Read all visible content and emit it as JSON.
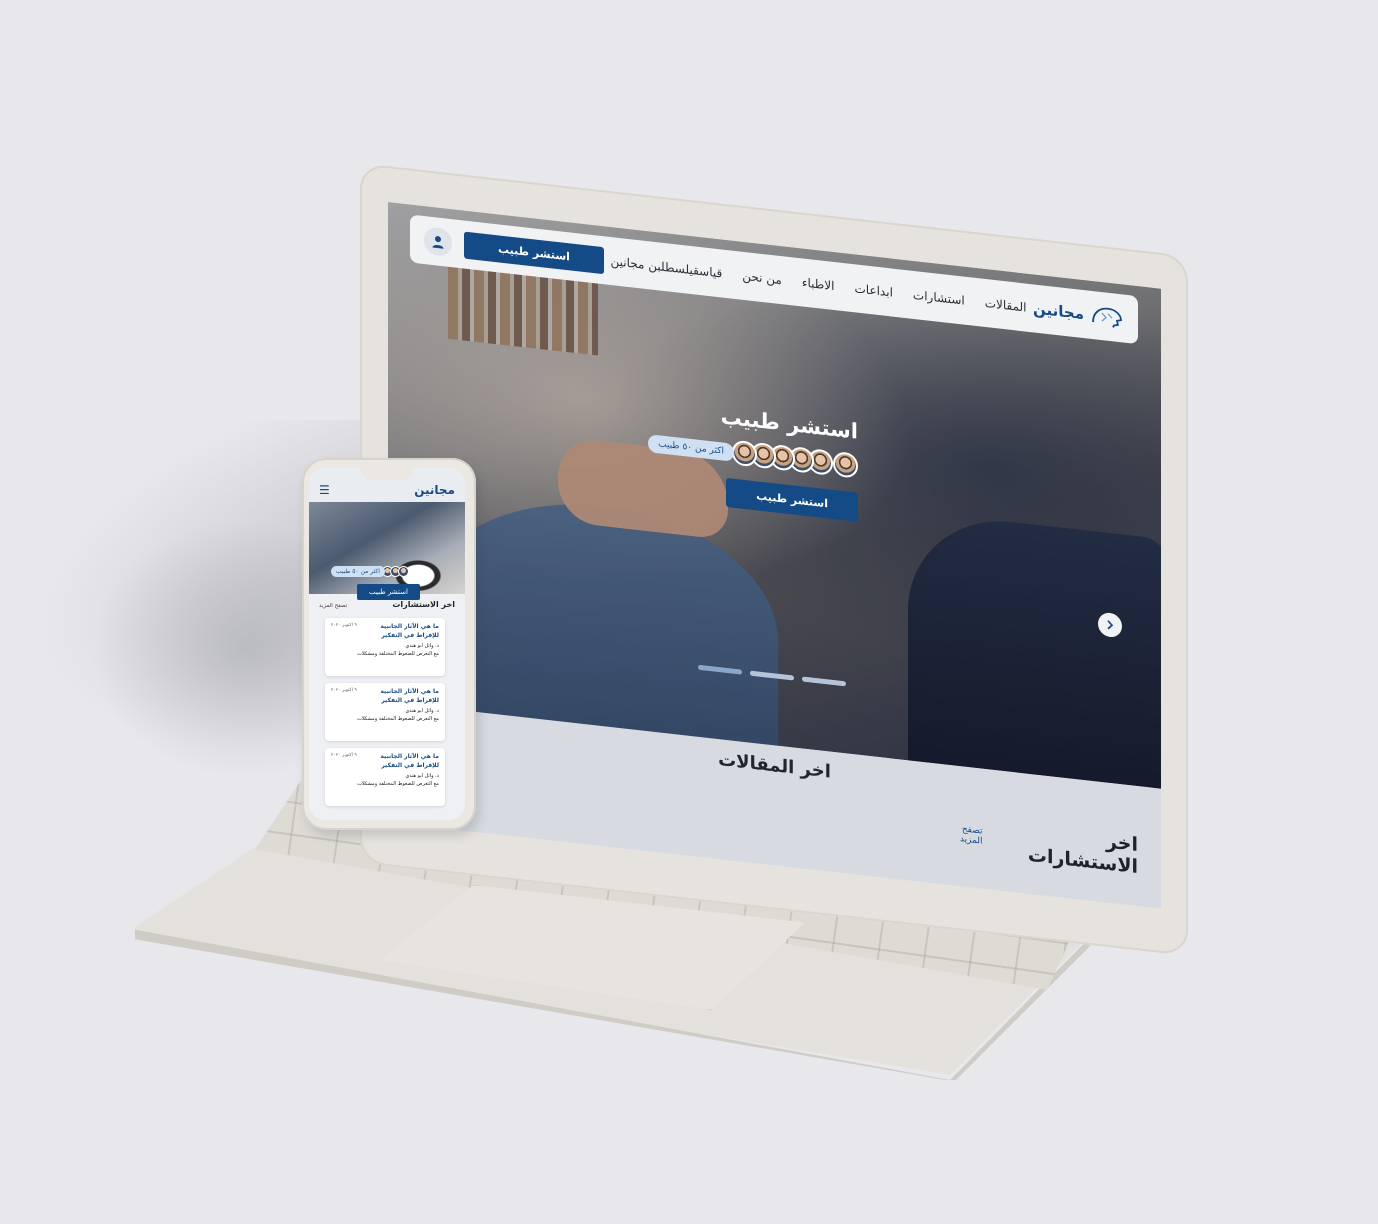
{
  "nav": {
    "logo": "مجانين",
    "links": [
      "المقالات",
      "استشارات",
      "ابداعات",
      "الاطباء",
      "من نحن",
      "قياسقيلسطلبن مجانين"
    ],
    "cta_label": "استشر طبيب"
  },
  "hero": {
    "title": "استشر طبيب",
    "doctors_badge": "اكثر من ٥٠ طبيب",
    "button_label": "استشر طبيب"
  },
  "sections": {
    "articles_title": "اخر المقالات",
    "consultations_title": "اخر الاستشارات",
    "more_link": "تصفح المزيد"
  },
  "mobile": {
    "logo": "مجانين",
    "badge": "اكثر من ٥٠ طبيب",
    "button_label": "استشر طبيب",
    "section_title": "اخر الاستشارات",
    "more_link": "تصفح المزيد",
    "cards": [
      {
        "question": "ما هي الآثار الجانبية للإفراط في التفكير",
        "date": "٩ اكتوبر ٢٠٢٠",
        "author": "د. وائل ابو هندي",
        "desc": "مع التعرض للضغوط المختلفة ومشكلات"
      },
      {
        "question": "ما هي الآثار الجانبية للإفراط في التفكير",
        "date": "٩ اكتوبر ٢٠٢٠",
        "author": "د. وائل ابو هندي",
        "desc": "مع التعرض للضغوط المختلفة ومشكلات"
      },
      {
        "question": "ما هي الآثار الجانبية للإفراط في التفكير",
        "date": "٩ اكتوبر ٢٠٢٠",
        "author": "د. وائل ابو هندي",
        "desc": "مع التعرض للضغوط المختلفة ومشكلات"
      }
    ]
  },
  "icons": {
    "logo": "brain-profile-logo-icon",
    "user": "user-icon",
    "next": "chevron-right-icon",
    "menu": "hamburger-menu-icon"
  },
  "colors": {
    "brand": "#144a85",
    "badge_bg": "#cfe0f2",
    "page_bg": "#e7e7ec"
  }
}
